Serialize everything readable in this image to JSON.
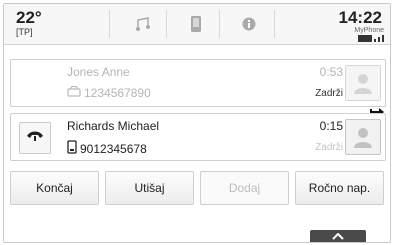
{
  "status_bar": {
    "temperature": "22°",
    "temperature_sub": "[TP]",
    "time": "14:22",
    "device": "MyPhone",
    "tabs": [
      {
        "icon": "music-note-icon"
      },
      {
        "icon": "phone-icon"
      },
      {
        "icon": "info-icon"
      }
    ]
  },
  "calls": [
    {
      "name": "Jones Anne",
      "number": "1234567890",
      "number_icon": "car-phone-icon",
      "duration": "0:53",
      "status": "Zadrži",
      "state": "on-hold"
    },
    {
      "name": "Richards Michael",
      "number": "9012345678",
      "number_icon": "mobile-phone-icon",
      "duration": "0:15",
      "status": "Zadrži",
      "state": "active",
      "hold_icon": "handset-icon"
    }
  ],
  "swap_icon": "swap-arrow-icon",
  "buttons": [
    {
      "label": "Končaj",
      "enabled": true
    },
    {
      "label": "Utišaj",
      "enabled": true
    },
    {
      "label": "Dodaj",
      "enabled": false
    },
    {
      "label": "Ročno nap.",
      "enabled": true
    }
  ],
  "footer": {
    "icon": "chevron-up-icon"
  }
}
